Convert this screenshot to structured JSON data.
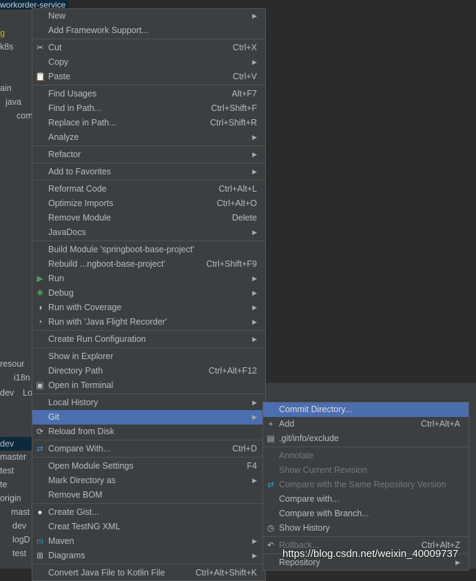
{
  "window_title": "workorder-service",
  "tree": [
    "g",
    "k8s",
    "ain",
    "java",
    "com",
    "resour",
    "i18n",
    "dev",
    "Lo"
  ],
  "branches": [
    "dev",
    "master",
    "test",
    "te",
    "origin",
    "mast",
    "dev",
    "logD",
    "test"
  ],
  "main_menu": [
    {
      "label": "New",
      "submenu": true
    },
    {
      "label": "Add Framework Support..."
    },
    {
      "sep": true
    },
    {
      "label": "Cut",
      "shortcut": "Ctrl+X",
      "icon": "scissors-icon"
    },
    {
      "label": "Copy",
      "submenu": true
    },
    {
      "label": "Paste",
      "shortcut": "Ctrl+V",
      "icon": "clipboard-icon"
    },
    {
      "sep": true
    },
    {
      "label": "Find Usages",
      "shortcut": "Alt+F7"
    },
    {
      "label": "Find in Path...",
      "shortcut": "Ctrl+Shift+F"
    },
    {
      "label": "Replace in Path...",
      "shortcut": "Ctrl+Shift+R"
    },
    {
      "label": "Analyze",
      "submenu": true
    },
    {
      "sep": true
    },
    {
      "label": "Refactor",
      "submenu": true
    },
    {
      "sep": true
    },
    {
      "label": "Add to Favorites",
      "submenu": true
    },
    {
      "sep": true
    },
    {
      "label": "Reformat Code",
      "shortcut": "Ctrl+Alt+L"
    },
    {
      "label": "Optimize Imports",
      "shortcut": "Ctrl+Alt+O"
    },
    {
      "label": "Remove Module",
      "shortcut": "Delete"
    },
    {
      "label": "JavaDocs",
      "submenu": true
    },
    {
      "sep": true
    },
    {
      "label": "Build Module 'springboot-base-project'"
    },
    {
      "label": "Rebuild ...ngboot-base-project'",
      "shortcut": "Ctrl+Shift+F9"
    },
    {
      "label": "Run",
      "submenu": true,
      "icon": "run-icon"
    },
    {
      "label": "Debug",
      "submenu": true,
      "icon": "debug-icon"
    },
    {
      "label": "Run with Coverage",
      "submenu": true,
      "icon": "coverage-icon"
    },
    {
      "label": "Run with 'Java Flight Recorder'",
      "submenu": true,
      "icon": "profiler-icon"
    },
    {
      "sep": true
    },
    {
      "label": "Create Run Configuration",
      "submenu": true
    },
    {
      "sep": true
    },
    {
      "label": "Show in Explorer"
    },
    {
      "label": "Directory Path",
      "shortcut": "Ctrl+Alt+F12"
    },
    {
      "label": "Open in Terminal",
      "icon": "terminal-icon"
    },
    {
      "sep": true
    },
    {
      "label": "Local History",
      "submenu": true
    },
    {
      "label": "Git",
      "submenu": true,
      "selected": true
    },
    {
      "label": "Reload from Disk",
      "icon": "reload-icon"
    },
    {
      "sep": true
    },
    {
      "label": "Compare With...",
      "shortcut": "Ctrl+D",
      "icon": "compare-icon"
    },
    {
      "sep": true
    },
    {
      "label": "Open Module Settings",
      "shortcut": "F4"
    },
    {
      "label": "Mark Directory as",
      "submenu": true
    },
    {
      "label": "Remove BOM"
    },
    {
      "sep": true
    },
    {
      "label": "Create Gist...",
      "icon": "github-icon"
    },
    {
      "label": "Creat TestNG XML"
    },
    {
      "label": "Maven",
      "submenu": true,
      "icon": "maven-icon"
    },
    {
      "label": "Diagrams",
      "submenu": true,
      "icon": "diagram-icon"
    },
    {
      "sep": true
    },
    {
      "label": "Convert Java File to Kotlin File",
      "shortcut": "Ctrl+Alt+Shift+K"
    }
  ],
  "git_menu": [
    {
      "label": "Commit Directory...",
      "selected": true
    },
    {
      "label": "Add",
      "shortcut": "Ctrl+Alt+A",
      "icon": "plus-icon"
    },
    {
      "label": ".git/info/exclude",
      "icon": "exclude-file-icon"
    },
    {
      "sep": true
    },
    {
      "label": "Annotate",
      "disabled": true
    },
    {
      "label": "Show Current Revision",
      "disabled": true
    },
    {
      "label": "Compare with the Same Repository Version",
      "disabled": true,
      "icon": "compare-icon"
    },
    {
      "label": "Compare with..."
    },
    {
      "label": "Compare with Branch..."
    },
    {
      "label": "Show History",
      "icon": "clock-icon"
    },
    {
      "sep": true
    },
    {
      "label": "Rollback...",
      "shortcut": "Ctrl+Alt+Z",
      "disabled": true,
      "icon": "rollback-icon"
    },
    {
      "sep": true
    },
    {
      "label": "Repository",
      "submenu": true
    }
  ],
  "watermark": "https://blog.csdn.net/weixin_40009737",
  "colors": {
    "menu_bg": "#3c3f41",
    "selection": "#4b6eaf",
    "editor_bg": "#2b2b2b"
  }
}
